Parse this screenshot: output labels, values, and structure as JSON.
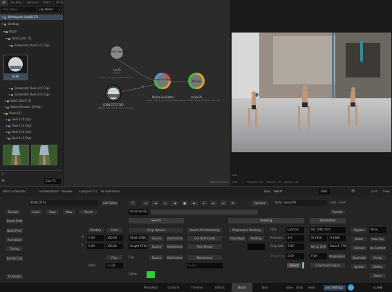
{
  "left_panel": {
    "tabs": [
      "All",
      "Desktop",
      "Libraries",
      "Batch",
      "ID:TE"
    ],
    "filter_placeholder": "Tree Name",
    "clip_name": "Clip Name",
    "tree": [
      {
        "label": "Workspace (hub0127)",
        "selected": true
      },
      {
        "label": "Desktop",
        "selected": false
      },
      {
        "label": "Batch",
        "selected": false
      },
      {
        "label": "Batch_001 (5)",
        "selected": false
      },
      {
        "label": "Schematic Reel 1 (1 Clip)",
        "selected": false
      }
    ],
    "thumb_label": "8388",
    "tree2": [
      "Schematic Reel 3 (0 Clip)",
      "Schematic Reel 4 (0 Clip)",
      "Batch Shelf (1)",
      "Batch Renders (0 Clip)",
      "Reels (5)",
      "Reel 1 (0 Clip)",
      "Reel 2 (0 Clip)",
      "Reel 3 (0 Clip)",
      "Reel 4 (2 Clip)"
    ],
    "size_value": "Size 73"
  },
  "schematic": {
    "nodes": [
      {
        "title": "Colour Source",
        "name": "cm79",
        "sub": "Shade",
        "info": "8086 x 5773 | 8 ft (DT) Unknown"
      },
      {
        "title": "",
        "name": "8388 DTS1780",
        "sub": "",
        "info": "8086 x 5773 | 8 ft (DT) Unknown"
      },
      {
        "title": "MUX/Lens Effects",
        "name": "MUsm3ueRHtan",
        "sub": "",
        "info": "8086 x 5773 | 8 ft (DT) Unknown"
      },
      {
        "title": "Resize",
        "name": "resize79",
        "sub": "",
        "info": "1920 x 1080 | 8 ft 1.778 (DT) Unknown"
      }
    ],
    "footer_label": "Batch Schematic"
  },
  "viewer": {
    "footer": [
      "Action",
      "Exposure: 0.00",
      "Contrast: 1.00",
      "Gamma: 1.00"
    ],
    "footer2": "Video"
  },
  "toolbar": {
    "tabs": [
      "Batch Schematic",
      "Full Resolution",
      "Preview",
      "Compare: (1)",
      "No Reference"
    ],
    "right_label": "Table",
    "right_value": "Result",
    "zoom": "1080",
    "grid_label": "Grid",
    "view_label": "View"
  },
  "editor": {
    "clip_field": "8586_DTS1",
    "add_token": "Add Token",
    "row2": [
      "Load",
      "Save",
      "New",
      "Reset"
    ],
    "timecode": "00:00:00:00",
    "frame": "1",
    "options_label": "Options",
    "note_label": "Note",
    "note_value": "resize79",
    "load_label": "Load",
    "save_label": "Save",
    "presets_label": "Presets",
    "render_label": "Render",
    "left_buttons": [
      "Batch Prefs",
      "Node Prefs",
      "Animation",
      "Timing",
      "Render List",
      "FX Nodes"
    ],
    "position_btn": "Position",
    "scale_btn": "Scale",
    "pos_x": "0.00",
    "pos_y": "0.00",
    "scale_x": "100.00",
    "scale_y": "100.00",
    "flop": "Flop",
    "flip": "Flip",
    "ratio_label": "Ratio",
    "ratio_value": "1.333",
    "search_header": "Search",
    "crop_options": "Crop Options",
    "source_pre": "Source Pre Rendering",
    "width_label": "Width 8586",
    "height_label": "Height 5782",
    "source_btn": "Source",
    "dest_btn": "Destination",
    "use_both": "Use Both Fields",
    "field_merge": "Field Merge",
    "deinterlace": "Deinterlace",
    "field_1": "Field 1",
    "clip_label": "Clip",
    "colour_label": "Colour",
    "resizing_header": "Resizing",
    "prog_res": "Progressive Resizing",
    "crop_edges": "Crop Edges",
    "padding": "Padding",
    "filter_label": "Filter",
    "filter_value": "Lanczos",
    "precision_label": "Precision",
    "precision_value": "8 ft",
    "crop_soft_label": "Crop Soft",
    "crop_soft_value": "0.00",
    "sharpness_label": "Sharpness",
    "sharpness_value": "0.00",
    "aspect_btn": "Aspect",
    "dest_header": "Destination",
    "dest_res": "HD 1080 16:9",
    "w_label": "W 1920",
    "h_label": "H 1080",
    "set_to": "Set to 16:9",
    "ratio_dest": "Ratio 1.778",
    "bit_depth": "8 bit",
    "progressive": "Progressive",
    "crop_out": "Crop/Load Output",
    "right_col": [
      "Bypass",
      "None",
      "Batch",
      "Auto Key",
      "Context",
      "Au Context",
      "Duplicate",
      "Group",
      "Update",
      "Delete",
      "Reset"
    ]
  },
  "bottom_tabs": [
    "MediaHub",
    "Conform",
    "Timeline",
    "Effects",
    "Batch",
    "Tools"
  ],
  "status": {
    "save": "Save",
    "undo": "Undo",
    "redo": "Redo",
    "user": "Last Settings",
    "app": "FLAME"
  },
  "colors": {
    "accent_green": "#33cc33",
    "node_orange": "#e0a030",
    "node_blue": "#4aa0e0",
    "selection": "#3c4a5c"
  }
}
